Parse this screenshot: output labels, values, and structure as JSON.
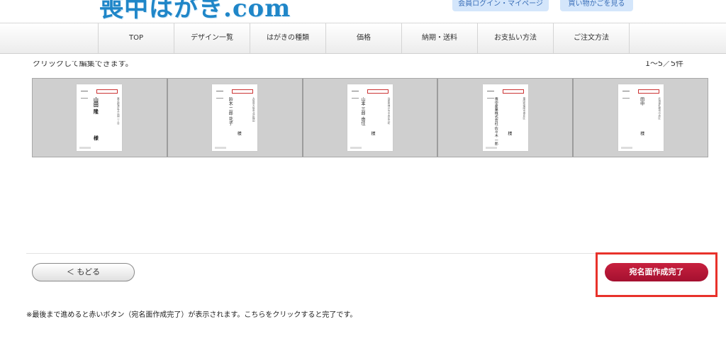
{
  "header": {
    "logo_text": "喪中はがき.com",
    "login_label": "会員ログイン・マイページ",
    "cart_label": "買い物かごを見る"
  },
  "nav": {
    "items": [
      {
        "label": "TOP"
      },
      {
        "label": "デザイン一覧"
      },
      {
        "label": "はがきの種類"
      },
      {
        "label": "価格"
      },
      {
        "label": "納期・送料"
      },
      {
        "label": "お支払い方法"
      },
      {
        "label": "ご注文方法"
      }
    ]
  },
  "content": {
    "instruction": "クリックして編集できます。",
    "count": "1～5／5件",
    "thumbnails": [
      {
        "name": "山田 隆",
        "suffix": "様"
      },
      {
        "name": "鈴木 二郎 花子",
        "suffix": "様"
      },
      {
        "name": "山本 三郎 由佳",
        "suffix": "様"
      },
      {
        "name": "喪中産業株式会社 佐々木 一郎",
        "suffix": "様"
      },
      {
        "name": "田中",
        "suffix": "様"
      }
    ]
  },
  "buttons": {
    "back_label": "＜ もどる",
    "done_label": "宛名面作成完了"
  },
  "note": "※最後まで進めると赤いボタン（宛名面作成完了）が表示されます。こちらをクリックすると完了です。",
  "colors": {
    "brand_blue": "#1f86c8",
    "done_red": "#b41535",
    "highlight_red": "#e8322b"
  }
}
